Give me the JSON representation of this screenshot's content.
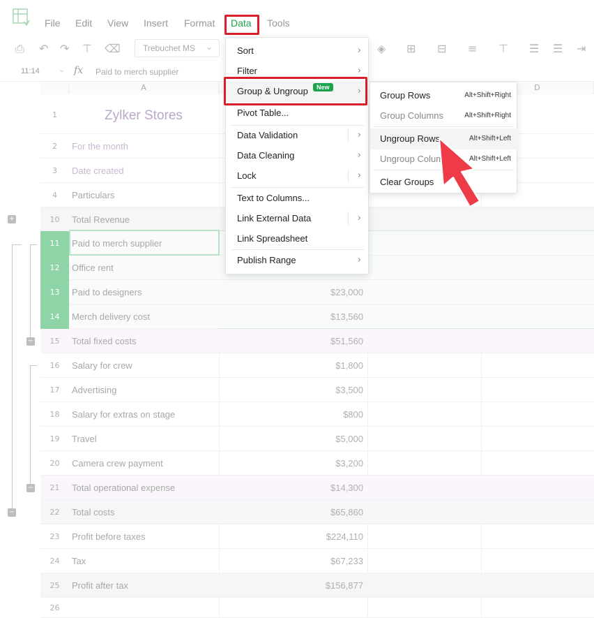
{
  "menubar": {
    "items": [
      "File",
      "Edit",
      "View",
      "Insert",
      "Format",
      "Data",
      "Tools"
    ],
    "active": "Data"
  },
  "toolbar": {
    "font": "Trebuchet MS"
  },
  "formula_bar": {
    "cell_ref": "11:14",
    "fx": "fx",
    "value": "Paid to merch supplier"
  },
  "columns": [
    "A",
    "D"
  ],
  "sheet_title": "Zylker Stores",
  "rows": [
    {
      "num": "1",
      "a": "",
      "b": ""
    },
    {
      "num": "2",
      "a": "For the month",
      "b": ""
    },
    {
      "num": "3",
      "a": "Date created",
      "b": ""
    },
    {
      "num": "4",
      "a": "Particulars",
      "b": ""
    },
    {
      "num": "10",
      "a": "Total Revenue",
      "b": ""
    },
    {
      "num": "11",
      "a": "Paid to merch supplier",
      "b": ""
    },
    {
      "num": "12",
      "a": "Office rent",
      "b": ""
    },
    {
      "num": "13",
      "a": "Paid to designers",
      "b": "$23,000"
    },
    {
      "num": "14",
      "a": "Merch delivery cost",
      "b": "$13,560"
    },
    {
      "num": "15",
      "a": "Total fixed costs",
      "b": "$51,560"
    },
    {
      "num": "16",
      "a": "Salary for crew",
      "b": "$1,800"
    },
    {
      "num": "17",
      "a": "Advertising",
      "b": "$3,500"
    },
    {
      "num": "18",
      "a": "Salary for extras on stage",
      "b": "$800"
    },
    {
      "num": "19",
      "a": "Travel",
      "b": "$5,000"
    },
    {
      "num": "20",
      "a": "Camera crew payment",
      "b": "$3,200"
    },
    {
      "num": "21",
      "a": "Total operational expense",
      "b": "$14,300"
    },
    {
      "num": "22",
      "a": "Total costs",
      "b": "$65,860"
    },
    {
      "num": "23",
      "a": "Profit before taxes",
      "b": "$224,110"
    },
    {
      "num": "24",
      "a": "Tax",
      "b": "$67,233"
    },
    {
      "num": "25",
      "a": "Profit after tax",
      "b": "$156,877"
    },
    {
      "num": "26",
      "a": "",
      "b": ""
    }
  ],
  "data_menu": {
    "sort": "Sort",
    "filter": "Filter",
    "group_ungroup": "Group & Ungroup",
    "new_badge": "New",
    "pivot": "Pivot Table...",
    "validation": "Data Validation",
    "cleaning": "Data Cleaning",
    "lock": "Lock",
    "text_to_columns": "Text to Columns...",
    "link_external": "Link External Data",
    "link_spreadsheet": "Link Spreadsheet",
    "publish_range": "Publish Range"
  },
  "group_submenu": {
    "group_rows": "Group Rows",
    "group_rows_key": "Alt+Shift+Right",
    "group_columns": "Group Columns",
    "group_columns_key": "Alt+Shift+Right",
    "ungroup_rows": "Ungroup Rows",
    "ungroup_rows_key": "Alt+Shift+Left",
    "ungroup_columns": "Ungroup Columns",
    "ungroup_columns_key": "Alt+Shift+Left",
    "clear_groups": "Clear Groups"
  },
  "colors": {
    "accent_green": "#1aa34a",
    "highlight_red": "#d9202a",
    "pointer_red": "#ef3b47"
  }
}
